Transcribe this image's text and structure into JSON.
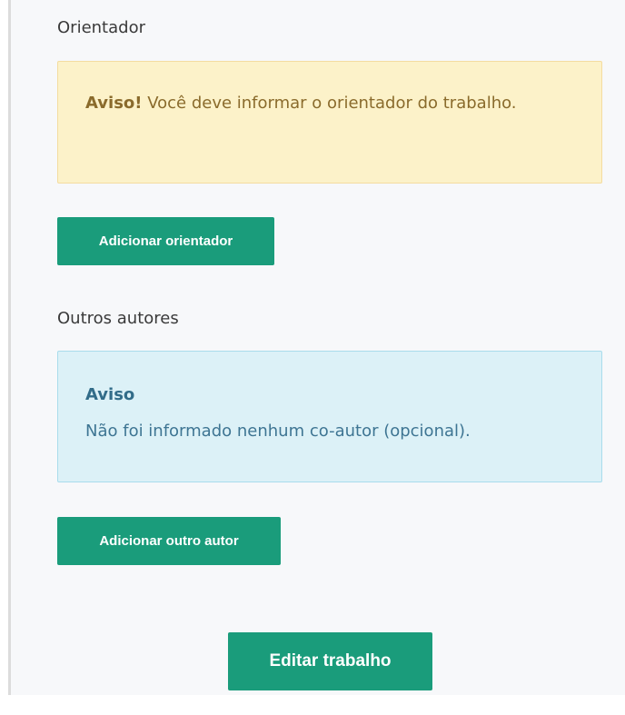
{
  "advisor_section": {
    "label": "Orientador",
    "warning": {
      "title": "Aviso!",
      "message": " Você deve informar o orientador do trabalho."
    },
    "add_button_label": "Adicionar orientador"
  },
  "coauthors_section": {
    "label": "Outros autores",
    "info": {
      "title": "Aviso",
      "message": "Não foi informado nenhum co-autor (opcional)."
    },
    "add_button_label": "Adicionar outro autor"
  },
  "footer": {
    "submit_label": "Editar trabalho"
  },
  "colors": {
    "primary_button": "#1a9c7b",
    "warning_bg": "#fcf2c9",
    "warning_border": "#f4dca0",
    "warning_text": "#8a6b2c",
    "info_bg": "#dcf1f7",
    "info_border": "#a9dcec",
    "info_text": "#3e7593",
    "panel_bg": "#f7f8fa"
  }
}
